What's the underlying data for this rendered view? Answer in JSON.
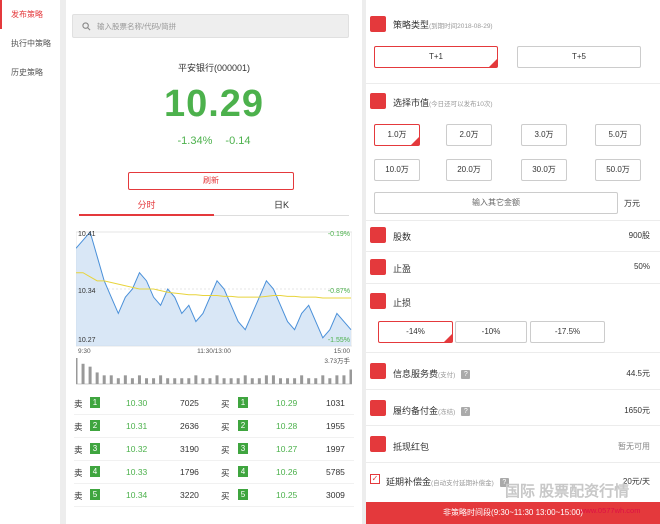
{
  "sidebar": {
    "items": [
      {
        "label": "发布策略"
      },
      {
        "label": "执行中策略"
      },
      {
        "label": "历史策略"
      }
    ]
  },
  "search": {
    "placeholder": "输入股票名称/代码/简拼"
  },
  "stock": {
    "name": "平安银行(000001)",
    "price": "10.29",
    "change_pct": "-1.34%",
    "change": "-0.14",
    "refresh": "刷新"
  },
  "tabs": [
    {
      "label": "分时"
    },
    {
      "label": "日K"
    }
  ],
  "chart_data": {
    "type": "line",
    "prices": [
      10.39,
      10.4,
      10.41,
      10.38,
      10.35,
      10.33,
      10.31,
      10.33,
      10.34,
      10.36,
      10.35,
      10.33,
      10.32,
      10.34,
      10.33,
      10.31,
      10.32,
      10.3,
      10.31,
      10.33,
      10.35,
      10.34,
      10.32,
      10.3,
      10.29,
      10.31,
      10.33,
      10.35,
      10.34,
      10.32,
      10.3,
      10.29,
      10.31,
      10.32,
      10.3,
      10.28,
      10.29,
      10.31,
      10.3,
      10.29
    ],
    "avg": [
      10.36,
      10.36,
      10.355,
      10.35,
      10.35,
      10.348,
      10.346,
      10.344,
      10.342,
      10.34,
      10.34,
      10.34,
      10.338,
      10.336,
      10.335,
      10.334,
      10.333,
      10.333,
      10.332,
      10.332,
      10.332,
      10.331,
      10.331,
      10.33,
      10.33,
      10.33,
      10.33,
      10.331,
      10.332,
      10.332,
      10.331,
      10.331,
      10.33,
      10.33,
      10.33,
      10.329,
      10.329,
      10.329,
      10.329,
      10.329
    ],
    "vol": [
      9,
      7,
      6,
      4,
      3,
      3,
      2,
      3,
      2,
      3,
      2,
      2,
      3,
      2,
      2,
      2,
      2,
      3,
      2,
      2,
      3,
      2,
      2,
      2,
      3,
      2,
      2,
      3,
      3,
      2,
      2,
      2,
      3,
      2,
      2,
      3,
      2,
      3,
      3,
      5
    ],
    "ylim": [
      10.27,
      10.41
    ],
    "yticks_left": [
      "10.41",
      "10.34",
      "10.27"
    ],
    "yticks_right": [
      "-0.19%",
      "-0.87%",
      "-1.55%"
    ],
    "xticks": [
      "9:30",
      "11:30/13:00",
      "15:00"
    ],
    "vol_label": "3.73万手"
  },
  "orderbook": {
    "sell": [
      {
        "label": "卖",
        "num": "1",
        "price": "10.30",
        "vol": "7025"
      },
      {
        "label": "卖",
        "num": "2",
        "price": "10.31",
        "vol": "2636"
      },
      {
        "label": "卖",
        "num": "3",
        "price": "10.32",
        "vol": "3190"
      },
      {
        "label": "卖",
        "num": "4",
        "price": "10.33",
        "vol": "1796"
      },
      {
        "label": "卖",
        "num": "5",
        "price": "10.34",
        "vol": "3220"
      }
    ],
    "buy": [
      {
        "label": "买",
        "num": "1",
        "price": "10.29",
        "vol": "1031"
      },
      {
        "label": "买",
        "num": "2",
        "price": "10.28",
        "vol": "1955"
      },
      {
        "label": "买",
        "num": "3",
        "price": "10.27",
        "vol": "1997"
      },
      {
        "label": "买",
        "num": "4",
        "price": "10.26",
        "vol": "5785"
      },
      {
        "label": "买",
        "num": "5",
        "price": "10.25",
        "vol": "3009"
      }
    ]
  },
  "strategy": {
    "title": "策略类型",
    "note": "(到期时间2018-08-29)",
    "options": [
      "T+1",
      "T+5"
    ]
  },
  "market": {
    "title": "选择市值",
    "note": "(今日还可以发布10次)",
    "options": [
      "1.0万",
      "2.0万",
      "3.0万",
      "5.0万",
      "10.0万",
      "20.0万",
      "30.0万",
      "50.0万"
    ],
    "custom_placeholder": "输入其它金额",
    "unit": "万元"
  },
  "shares": {
    "label": "股数",
    "value": "900股"
  },
  "profit": {
    "label": "止盈",
    "value": "50%"
  },
  "loss": {
    "label": "止损",
    "options": [
      "-14%",
      "-10%",
      "-17.5%"
    ]
  },
  "fee": {
    "label": "信息服务费",
    "note": "(支付)",
    "value": "44.5元"
  },
  "deposit": {
    "label": "履约备付金",
    "note": "(冻结)",
    "value": "1650元"
  },
  "redpacket": {
    "label": "抵现红包",
    "value": "暂无可用"
  },
  "deferred": {
    "label": "延期补偿金",
    "note": "(自动支付延期补偿金)",
    "value": "20元/天"
  },
  "bottom": {
    "text": "非策略时间段(9:30~11:30 13:00~15:00)"
  },
  "watermark": {
    "text1": "国际 股票配资行情",
    "text2": "www.0577wh.com"
  }
}
